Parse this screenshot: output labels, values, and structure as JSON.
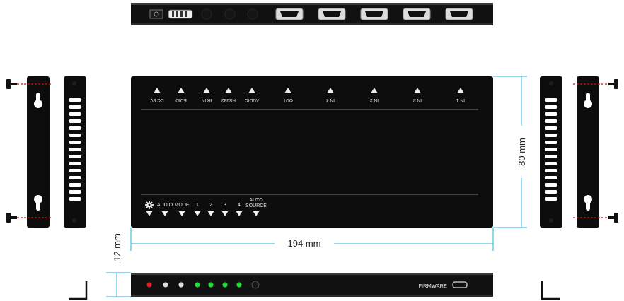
{
  "top_ports": [
    "OUT",
    "IN 4",
    "IN 3",
    "IN 2",
    "IN 1"
  ],
  "top_left_ports": [
    "DC 5V",
    "EDID",
    "IR IN",
    "RS232",
    "AUDIO"
  ],
  "buttons": [
    "AUDIO",
    "MODE",
    "1",
    "2",
    "3",
    "4"
  ],
  "auto_source_line1": "AUTO",
  "auto_source_line2": "SOURCE",
  "firmware_label": "FIRMWARE",
  "dimensions": {
    "width": "194 mm",
    "height": "80 mm",
    "depth": "12 mm"
  },
  "leds": [
    {
      "color": "#e02020"
    },
    {
      "color": "#dddddd"
    },
    {
      "color": "#dddddd"
    },
    {
      "color": "#22dd33"
    },
    {
      "color": "#22dd33"
    },
    {
      "color": "#22dd33"
    },
    {
      "color": "#22dd33"
    }
  ],
  "colors": {
    "body": "#0d0d0d",
    "dimension_line": "#2ab0e0",
    "screw_dash": "#d01010"
  }
}
